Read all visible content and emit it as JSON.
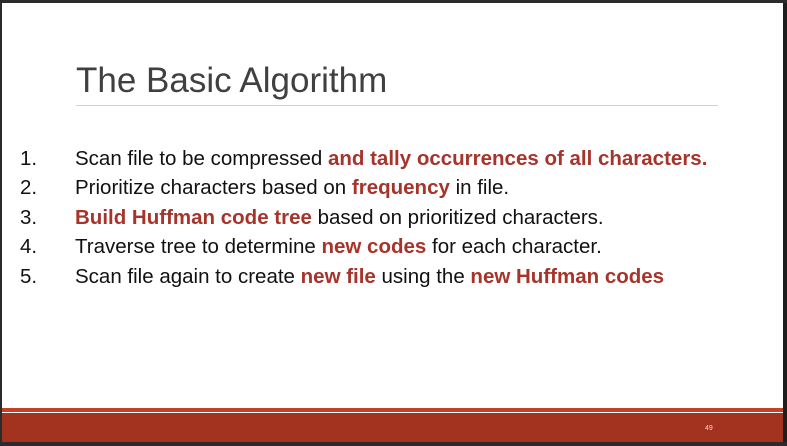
{
  "slide": {
    "title": "The Basic Algorithm",
    "steps": [
      {
        "number": "1.",
        "parts": [
          "Scan file to be compressed ",
          "and tally occurrences of all characters.",
          "",
          "",
          ""
        ]
      },
      {
        "number": "2.",
        "parts": [
          "Prioritize characters based on ",
          "frequency",
          " in file.",
          "",
          ""
        ]
      },
      {
        "number": "3.",
        "parts": [
          "",
          "Build Huffman code tree",
          " based on prioritized characters.",
          "",
          ""
        ]
      },
      {
        "number": "4.",
        "parts": [
          "Traverse tree to determine ",
          "new codes",
          " for each character.",
          "",
          ""
        ]
      },
      {
        "number": "5.",
        "parts": [
          "Scan file again to create ",
          "new file",
          " using the ",
          "new Huffman codes",
          ""
        ]
      }
    ],
    "slide_number": "49"
  },
  "colors": {
    "accent": "#a6342b",
    "footer_bar": "#a3321f",
    "footer_line": "#c64024",
    "title_text": "#404040"
  }
}
